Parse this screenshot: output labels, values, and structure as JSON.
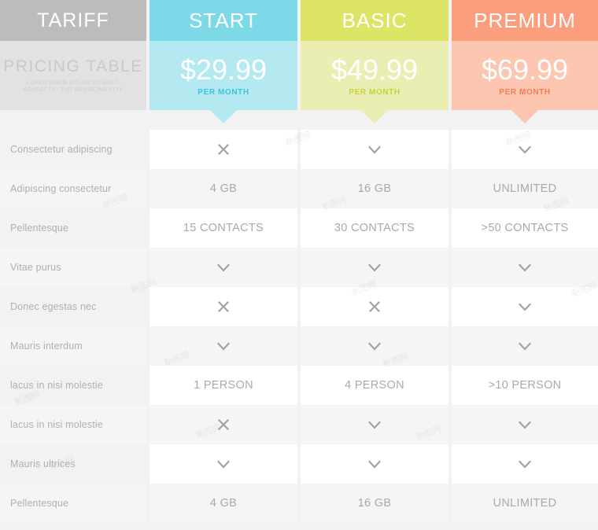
{
  "colors": {
    "tariff_head": "#bcbcbc",
    "tariff_body": "#e2e2e2",
    "start_head": "#7dd9e8",
    "start_body": "#b4e9f2",
    "basic_head": "#dce566",
    "basic_body": "#eaeeb2",
    "premium_head": "#fb9e7e",
    "premium_body": "#fcc6b1",
    "start_period_text": "#3dc3da",
    "basic_period_text": "#c6d23c",
    "premium_period_text": "#f57b52",
    "row_light": "#ffffff",
    "row_dark": "#f5f5f5",
    "page_bg": "#f2f2f2",
    "label_text": "#b0b0b0",
    "value_text": "#a9a9a9",
    "icon": "#a0a0a0"
  },
  "header": {
    "tariff": {
      "title": "TARIFF",
      "subtitle": "PRICING TABLE",
      "description": "LOREM IPSUM DOLOR SIT AMET, CONSECTE    -  TUR ADIPISCING ELIT."
    },
    "plans": [
      {
        "name": "START",
        "price": "$29.99",
        "period": "PER MONTH"
      },
      {
        "name": "BASIC",
        "price": "$49.99",
        "period": "PER MONTH"
      },
      {
        "name": "PREMIUM",
        "price": "$69.99",
        "period": "PER MONTH"
      }
    ]
  },
  "rows": [
    {
      "label": "Consectetur adipiscing",
      "values": [
        "cross",
        "check",
        "check"
      ]
    },
    {
      "label": "Adipiscing consectetur",
      "values": [
        "4 GB",
        "16 GB",
        "UNLIMITED"
      ]
    },
    {
      "label": "Pellentesque",
      "values": [
        "15 CONTACTS",
        "30 CONTACTS",
        ">50 CONTACTS"
      ]
    },
    {
      "label": "Vitae purus",
      "values": [
        "check",
        "check",
        "check"
      ]
    },
    {
      "label": "Donec egestas nec",
      "values": [
        "cross",
        "cross",
        "check"
      ]
    },
    {
      "label": "Mauris interdum",
      "values": [
        "check",
        "check",
        "check"
      ]
    },
    {
      "label": "lacus in nisi molestie",
      "values": [
        "1 PERSON",
        "4 PERSON",
        ">10 PERSON"
      ]
    },
    {
      "label": "lacus in nisi molestie",
      "values": [
        "cross",
        "check",
        "check"
      ]
    },
    {
      "label": "Mauris ultrices",
      "values": [
        "check",
        "check",
        "check"
      ]
    },
    {
      "label": "Pellentesque",
      "values": [
        "4 GB",
        "16 GB",
        "UNLIMITED"
      ]
    }
  ],
  "icons": {
    "check": "chevron-check-icon",
    "cross": "cross-icon"
  },
  "watermark": {
    "text": "新图网"
  }
}
